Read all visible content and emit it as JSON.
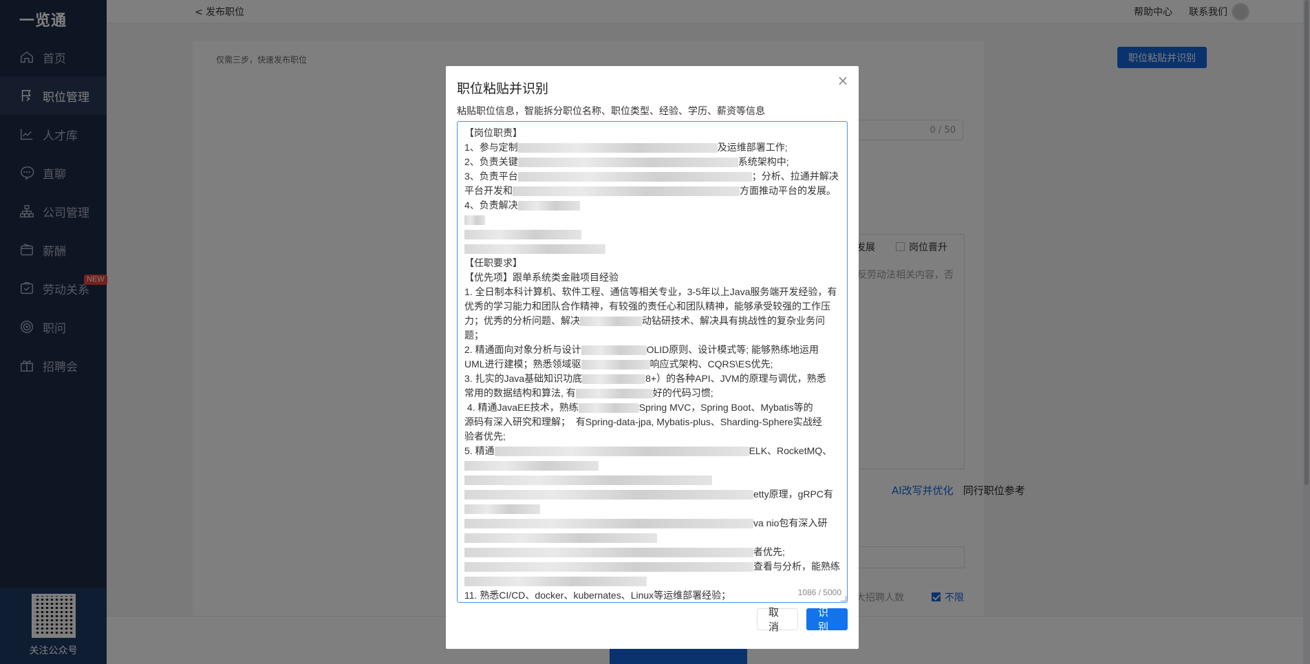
{
  "app": {
    "logo": "一览通"
  },
  "sidebar": {
    "items": [
      {
        "label": "首页",
        "icon": "home-icon"
      },
      {
        "label": "职位管理",
        "icon": "flag-icon",
        "active": true
      },
      {
        "label": "人才库",
        "icon": "chart-icon"
      },
      {
        "label": "直聊",
        "icon": "chat-icon"
      },
      {
        "label": "公司管理",
        "icon": "org-icon"
      },
      {
        "label": "薪酬",
        "icon": "wallet-icon"
      },
      {
        "label": "劳动关系",
        "icon": "shield-icon",
        "badge": "NEW"
      },
      {
        "label": "职问",
        "icon": "target-icon"
      },
      {
        "label": "招聘会",
        "icon": "gift-icon"
      }
    ],
    "qr_label": "关注公众号"
  },
  "header": {
    "back_label": "< 发布职位",
    "help": "帮助中心",
    "contact": "联系我们"
  },
  "page": {
    "hint": "仅需三步，快速发布职位",
    "paste_button": "职位粘贴并识别",
    "title_counter": "0 / 50",
    "option_develop": "发展",
    "option_promotion": "岗位晋升",
    "law_hint": "反劳动法相关内容，否",
    "ai_rewrite": "AI改写并优化",
    "peer_reference": "同行职位参考",
    "max_hires": "大招聘人数",
    "unlimited": "不限"
  },
  "modal": {
    "title": "职位粘贴并识别",
    "description": "粘贴职位信息，智能拆分职位名称、职位类型、经验、学历、薪资等信息",
    "char_count": "1086 / 5000",
    "cancel_label": "取消",
    "confirm_label": "识别",
    "lines": {
      "l1": "【岗位职责】",
      "l2a": "1、参与定制",
      "l2b": "及运维部署工作;",
      "l3a": "2、负责关键",
      "l3b": "系统架构中;",
      "l4a": "3、负责平台",
      "l4b": "；分析、拉通并解决",
      "l5a": "平台开发和",
      "l5b": "方面推动平台的发展。",
      "l6a": "4、负责解决",
      "l7": "【任职要求】",
      "l8": "【优先项】跟单系统类金融项目经验",
      "l9": "1. 全日制本科计算机、软件工程、通信等相关专业，3-5年以上Java服务端开发经验，有",
      "l10": "优秀的学习能力和团队合作精神，有较强的责任心和团队精神，能够承受较强的工作压",
      "l11a": "力；优秀的分析问题、解决",
      "l11b": "动钻研技术、解决具有挑战性的复杂业务问",
      "l12": "题；",
      "l13a": "2. 精通面向对象分析与设计",
      "l13b": "OLID原则、设计模式等; 能够熟练地运用",
      "l14a": "UML进行建模；熟悉领域驱",
      "l14b": "响应式架构、CQRS\\ES优先;",
      "l15a": "3. 扎实的Java基础知识功底",
      "l15b": "8+）的各种API、JVM的原理与调优，熟悉",
      "l16a": "常用的数据结构和算法, 有",
      "l16b": "好的代码习惯;",
      "l17a": " 4. 精通JavaEE技术，熟练",
      "l17b": "Spring MVC，Spring Boot、Mybatis等的",
      "l18": "源码有深入研究和理解；  有Spring-data-jpa, Mybatis-plus、Sharding-Sphere实战经",
      "l19": "验者优先;",
      "l20a": "5. 精通",
      "l20b": "ELK、RocketMQ、",
      "l21b": "etty原理，gRPC有",
      "l22b": "va nio包有深入研",
      "l23b": "者优先;",
      "l24b": "查看与分析，能熟练",
      "l25": "11. 熟悉CI/CD、docker、kubernates、Linux等运维部署经验；"
    }
  }
}
